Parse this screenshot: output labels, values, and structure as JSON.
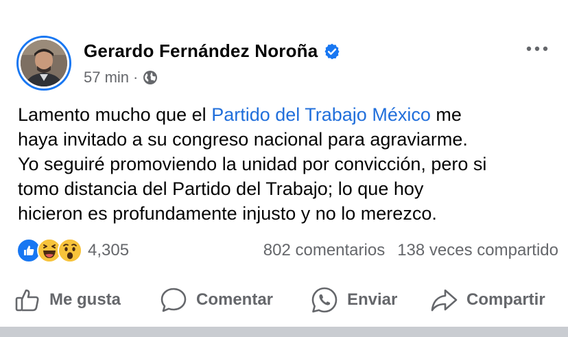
{
  "post": {
    "author": "Gerardo Fernández Noroña",
    "time": "57 min",
    "separator": "·",
    "text": {
      "line1_before": "Lamento mucho que el ",
      "line1_link": "Partido del Trabajo México",
      "line1_after": " me",
      "line2": "haya invitado a su congreso nacional para agraviarme.",
      "line3": "Yo seguiré promoviendo la unidad por convicción, pero si",
      "line4": "tomo distancia del Partido del Trabajo; lo que hoy",
      "line5": "hicieron es profundamente injusto y no lo merezco."
    }
  },
  "stats": {
    "reactions_count": "4,305",
    "comments": "802 comentarios",
    "shares": "138 veces compartido",
    "reaction_icons": [
      "like-icon",
      "haha-icon",
      "wow-icon"
    ]
  },
  "actions": {
    "like": "Me gusta",
    "comment": "Comentar",
    "send": "Enviar",
    "share": "Compartir"
  },
  "colors": {
    "accent": "#1877f2",
    "link": "#216fdb",
    "secondary_text": "#65676b",
    "haha_yellow": "#f7c33b"
  }
}
